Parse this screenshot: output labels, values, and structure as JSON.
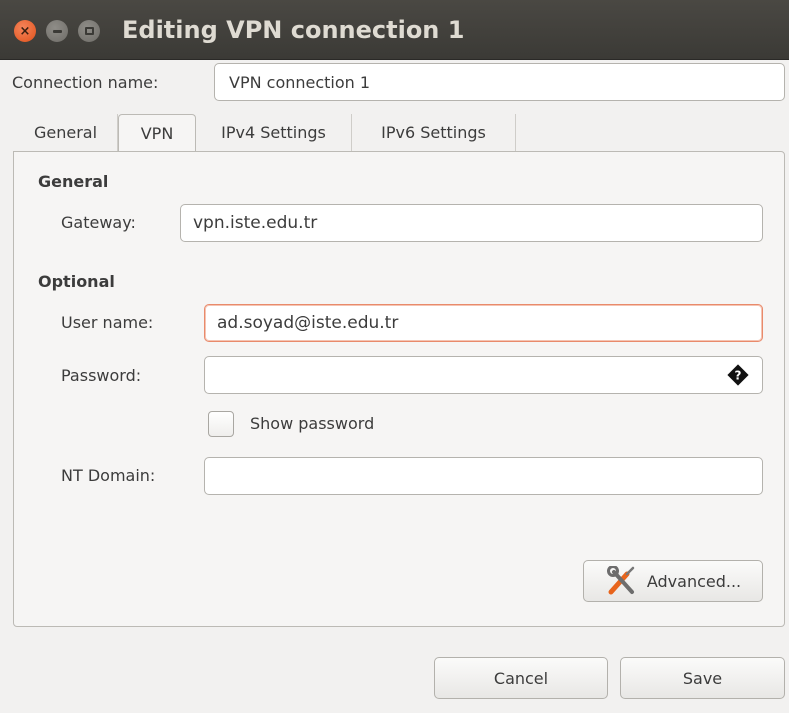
{
  "window": {
    "title": "Editing VPN connection 1",
    "controls": {
      "close": "×",
      "minimize": "minimize",
      "maximize": "maximize"
    }
  },
  "connection": {
    "label": "Connection name:",
    "value": "VPN connection 1"
  },
  "tabs": [
    {
      "label": "General",
      "active": false
    },
    {
      "label": "VPN",
      "active": true
    },
    {
      "label": "IPv4 Settings",
      "active": false
    },
    {
      "label": "IPv6 Settings",
      "active": false
    }
  ],
  "vpn": {
    "general_heading": "General",
    "gateway_label": "Gateway:",
    "gateway_value": "vpn.iste.edu.tr",
    "optional_heading": "Optional",
    "username_label": "User name:",
    "username_value": "ad.soyad@iste.edu.tr",
    "password_label": "Password:",
    "password_value": "",
    "password_icon": "password-storage-icon",
    "show_password_label": "Show password",
    "show_password_checked": false,
    "ntdomain_label": "NT Domain:",
    "ntdomain_value": "",
    "advanced_label": "Advanced...",
    "advanced_icon": "tools-icon"
  },
  "footer": {
    "cancel_label": "Cancel",
    "save_label": "Save"
  },
  "colors": {
    "titlebar": "#3b3a36",
    "close_button": "#e0521b",
    "focus_border": "#e98a6b",
    "background": "#f2f1f0"
  }
}
